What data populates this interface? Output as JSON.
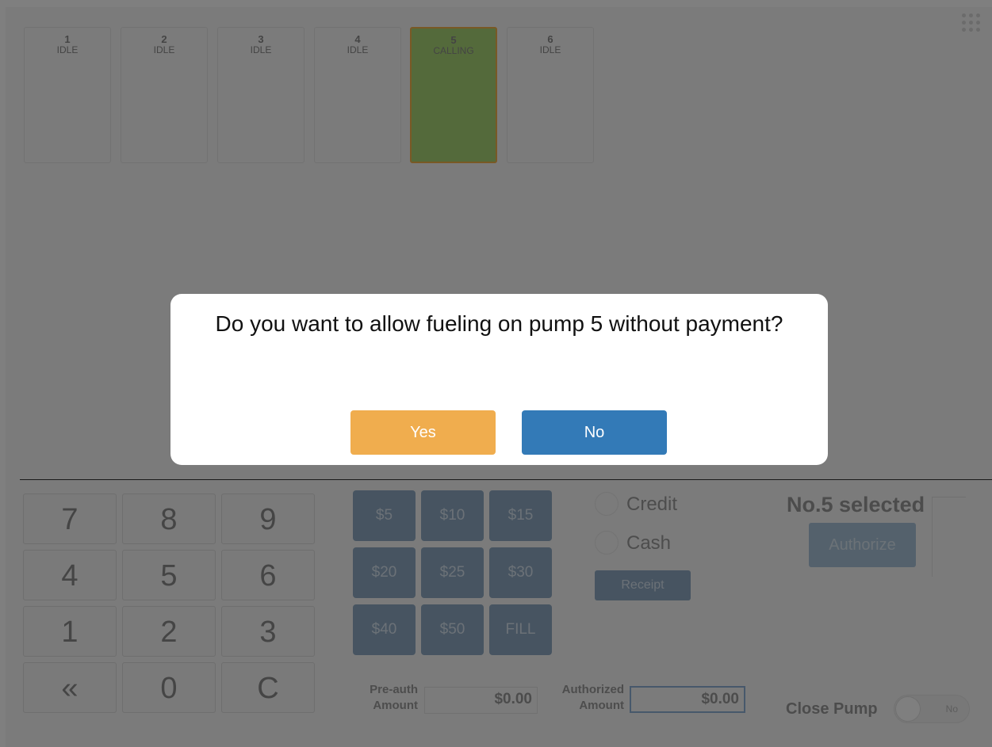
{
  "pumps": [
    {
      "number": "1",
      "status": "IDLE"
    },
    {
      "number": "2",
      "status": "IDLE"
    },
    {
      "number": "3",
      "status": "IDLE"
    },
    {
      "number": "4",
      "status": "IDLE"
    },
    {
      "number": "5",
      "status": "CALLING"
    },
    {
      "number": "6",
      "status": "IDLE"
    }
  ],
  "keypad": {
    "k7": "7",
    "k8": "8",
    "k9": "9",
    "k4": "4",
    "k5": "5",
    "k6": "6",
    "k1": "1",
    "k2": "2",
    "k3": "3",
    "back": "«",
    "k0": "0",
    "clear": "C"
  },
  "amounts": {
    "a5": "$5",
    "a10": "$10",
    "a15": "$15",
    "a20": "$20",
    "a25": "$25",
    "a30": "$30",
    "a40": "$40",
    "a50": "$50",
    "fill": "FILL"
  },
  "payment": {
    "credit": "Credit",
    "cash": "Cash",
    "receipt": "Receipt"
  },
  "selection": {
    "label": "No.5 selected",
    "authorize": "Authorize"
  },
  "fields": {
    "preauth_label_1": "Pre-auth",
    "preauth_label_2": "Amount",
    "preauth_value": "$0.00",
    "authorized_label_1": "Authorized",
    "authorized_label_2": "Amount",
    "authorized_value": "$0.00"
  },
  "close_pump": {
    "label": "Close Pump",
    "toggle_state": "No"
  },
  "dialog": {
    "message": "Do you want to allow fueling on pump 5 without payment?",
    "yes": "Yes",
    "no": "No"
  },
  "icons": {
    "menu": "grid-icon"
  },
  "colors": {
    "calling_fill": "#a9d576",
    "calling_border": "#f2b24b",
    "yes": "#f0ad4e",
    "no": "#337ab7"
  }
}
